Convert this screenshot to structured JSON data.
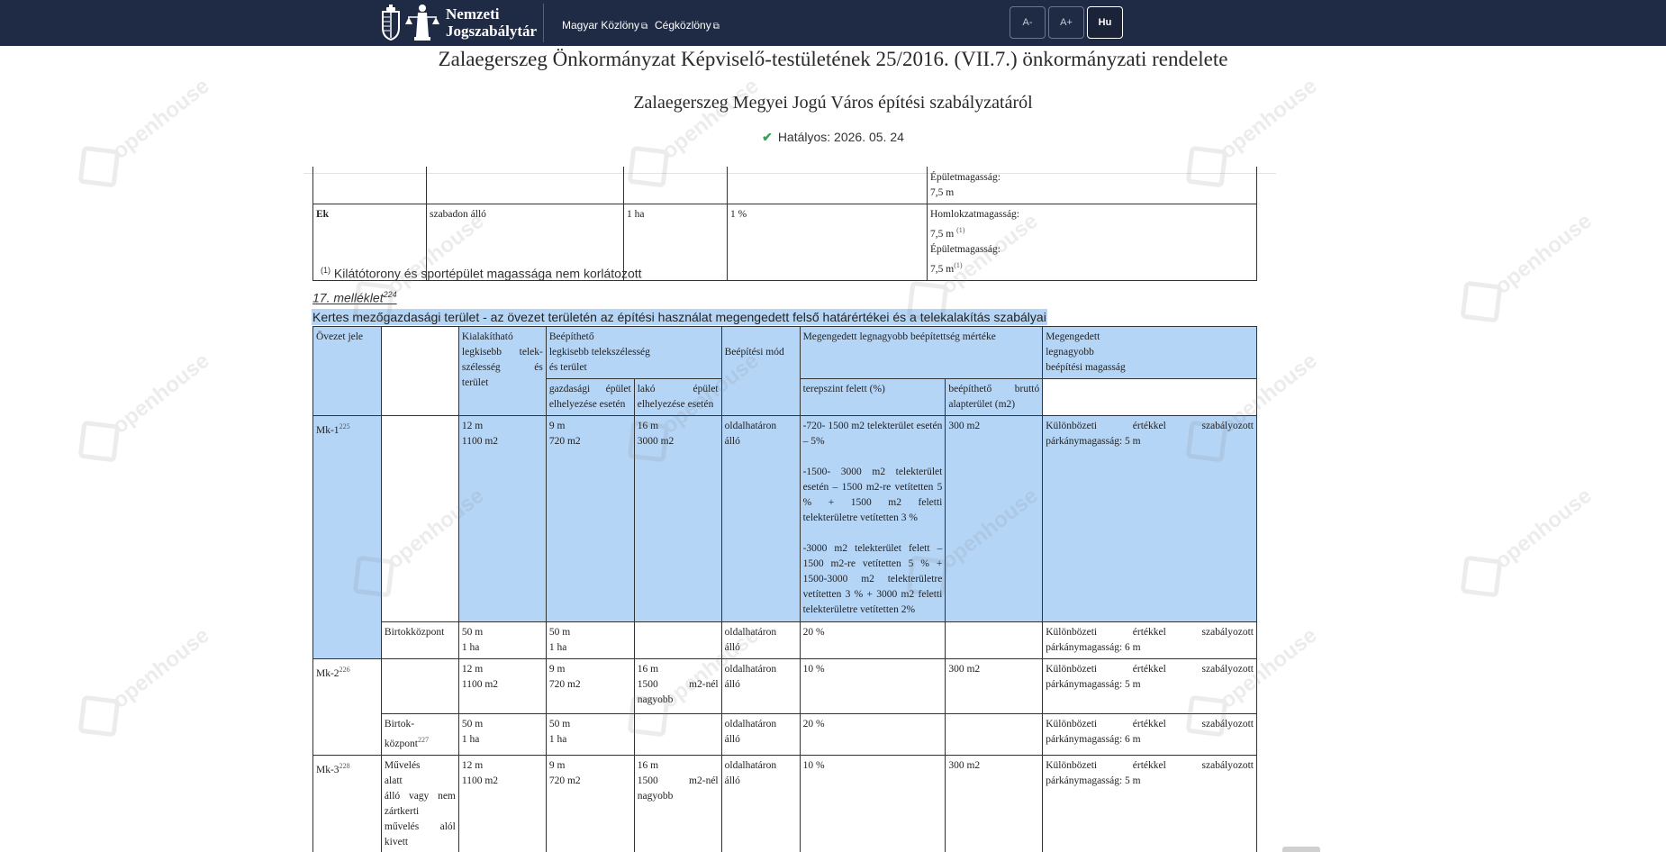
{
  "topbar": {
    "logo_line1": "Nemzeti",
    "logo_line2": "Jogszabálytár",
    "links": [
      "Magyar Közlöny",
      "Cégközlöny"
    ],
    "font_smaller": "A-",
    "font_larger": "A+",
    "language": "Hu"
  },
  "header": {
    "title": "Zalaegerszeg Önkormányzat Képviselő-testületének 25/2016. (VII.7.) önkormányzati rendelete",
    "subtitle": "Zalaegerszeg Megyei Jogú Város építési szabályzatáról",
    "status": "Hatályos: 2026. 05. 24"
  },
  "upper_table": {
    "partial_row": {
      "height_label": "Épületmagasság:",
      "height_value": "7,5 m"
    },
    "ek_row": {
      "code": "Ek",
      "mode": "szabadon álló",
      "area": "1 ha",
      "coverage": "1 %",
      "facade_label": "Homlokzatmagasság:",
      "facade_value": "7,5 m",
      "facade_ref": "(1)",
      "building_label": "Épületmagasság:",
      "building_value": "7,5 m",
      "building_ref": "(1)"
    }
  },
  "footnote": {
    "ref": "(1)",
    "text": "Kilátótorony és sportépület magassága nem korlátozott"
  },
  "annex": {
    "label": "17. melléklet",
    "ref": "224"
  },
  "caption": "Kertes mezőgazdasági terület - az övezet területén az építési használat megengedett felső határértékei és a telekalakítás szabályai",
  "table": {
    "headers": {
      "zone": "Övezet jele",
      "min_plot": [
        "Kialakítható",
        "legkisebb telek-",
        "szélesség és",
        "terület"
      ],
      "buildable": [
        "Beépíthető",
        "legkisebb telekszélesség",
        "és terület"
      ],
      "farm": [
        "gazdasági épület",
        "elhelyezése esetén"
      ],
      "residential": [
        "lakó épület",
        "elhelyezése esetén"
      ],
      "mode": "Beépítési mód",
      "coverage": "Megengedett legnagyobb beépítettség mértéke",
      "above_ground": "terepszint felett (%)",
      "gross_floor": [
        "beépíthető bruttó",
        "alapterület (m2)"
      ],
      "height": [
        "Megengedett",
        "legnagyobb",
        "beépítési magasság"
      ]
    },
    "mk1": {
      "code": "Mk-1",
      "ref": "225",
      "min_plot": [
        "12 m",
        "1100 m2"
      ],
      "farm": [
        "9 m",
        "720 m2"
      ],
      "residential": [
        "16 m",
        "3000 m2"
      ],
      "mode": [
        "oldalhatáron",
        "álló"
      ],
      "coverage": [
        "-720- 1500 m2 telekterület esetén – 5%",
        "-1500- 3000 m2 telekterület esetén – 1500 m2-re vetítetten 5 % + 1500 m2 feletti telekterületre vetítetten 3 %",
        "-3000 m2 telekterület felett – 1500 m2-re vetítetten 5 % + 1500-3000 m2 telekterületre vetítetten 3 % + 3000 m2 feletti telekterületre vetítetten 2%"
      ],
      "gross": "300 m2",
      "height": [
        "Különbözeti értékkel szabályozott",
        "párkánymagasság: 5 m"
      ]
    },
    "mk1_center": {
      "name": "Birtokközpont",
      "min_plot": [
        "50 m",
        "1 ha"
      ],
      "farm": [
        "50 m",
        "1 ha"
      ],
      "mode": [
        "oldalhatáron",
        "álló"
      ],
      "coverage": "20 %",
      "height": [
        "Különbözeti értékkel szabályozott",
        "párkánymagasság: 6 m"
      ]
    },
    "mk2": {
      "code": "Mk-2",
      "ref": "226",
      "min_plot": [
        "12 m",
        "1100 m2"
      ],
      "farm": [
        "9 m",
        "720 m2"
      ],
      "residential": [
        "16 m",
        "1500 m2-nél",
        "nagyobb"
      ],
      "mode": [
        "oldalhatáron",
        "álló"
      ],
      "coverage": "10 %",
      "gross": "300 m2",
      "height": [
        "Különbözeti értékkel szabályozott",
        "párkánymagasság: 5 m"
      ]
    },
    "mk2_center": {
      "name": [
        "Birtok-",
        "központ"
      ],
      "ref": "227",
      "min_plot": [
        "50 m",
        "1 ha"
      ],
      "farm": [
        "50 m",
        "1 ha"
      ],
      "mode": [
        "oldalhatáron",
        "álló"
      ],
      "coverage": "20 %",
      "height": [
        "Különbözeti értékkel szabályozott",
        "párkánymagasság: 6 m"
      ]
    },
    "mk3": {
      "code": "Mk-3",
      "ref": "228",
      "sub": [
        "Művelés",
        "alatt",
        "álló vagy nem",
        "zártkerti",
        "művelés alól",
        "kivett"
      ],
      "min_plot": [
        "12 m",
        "1100 m2"
      ],
      "farm": [
        "9 m",
        "720 m2"
      ],
      "residential": [
        "16 m",
        "1500 m2-nél",
        "nagyobb"
      ],
      "mode": [
        "oldalhatáron",
        "álló"
      ],
      "coverage": "10 %",
      "gross": "300 m2",
      "height": [
        "Különbözeti értékkel szabályozott",
        "párkánymagasság: 5 m"
      ]
    }
  },
  "watermark_text": "openhouse"
}
